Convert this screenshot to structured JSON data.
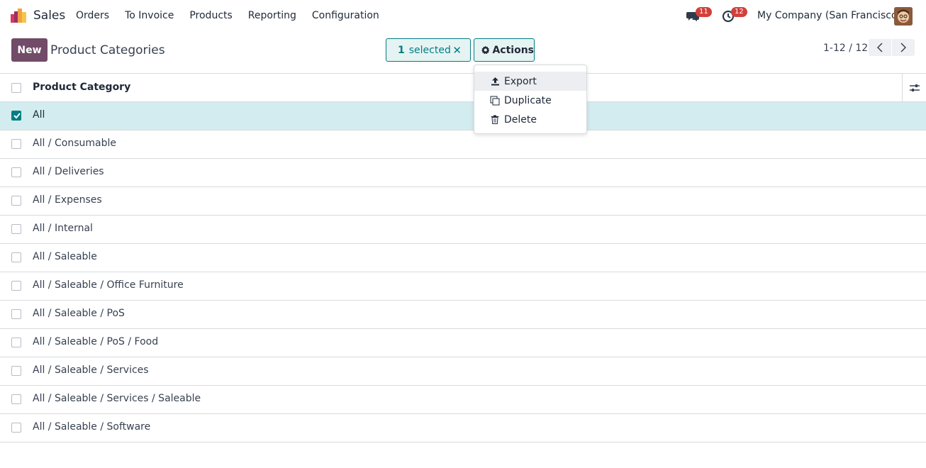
{
  "navbar": {
    "app_name": "Sales",
    "menu": [
      "Orders",
      "To Invoice",
      "Products",
      "Reporting",
      "Configuration"
    ],
    "chat_badge": "11",
    "activity_badge": "12",
    "company": "My Company (San Francisco)"
  },
  "control_panel": {
    "new_label": "New",
    "title": "Product Categories",
    "selected_count": "1",
    "selected_label": "selected",
    "actions_label": "Actions",
    "pager": "1-12 / 12"
  },
  "table": {
    "header": "Product Category",
    "rows": [
      {
        "name": "All",
        "selected": true
      },
      {
        "name": "All / Consumable",
        "selected": false
      },
      {
        "name": "All / Deliveries",
        "selected": false
      },
      {
        "name": "All / Expenses",
        "selected": false
      },
      {
        "name": "All / Internal",
        "selected": false
      },
      {
        "name": "All / Saleable",
        "selected": false
      },
      {
        "name": "All / Saleable / Office Furniture",
        "selected": false
      },
      {
        "name": "All / Saleable / PoS",
        "selected": false
      },
      {
        "name": "All / Saleable / PoS / Food",
        "selected": false
      },
      {
        "name": "All / Saleable / Services",
        "selected": false
      },
      {
        "name": "All / Saleable / Services / Saleable",
        "selected": false
      },
      {
        "name": "All / Saleable / Software",
        "selected": false
      }
    ]
  },
  "actions_menu": {
    "items": [
      "Export",
      "Duplicate",
      "Delete"
    ],
    "active": "Export"
  },
  "colors": {
    "brand": "#714b67",
    "accent": "#017e84",
    "selected_row": "#d3ecf0",
    "badge": "#d23f3a"
  },
  "icons": [
    "sales-logo-icon",
    "chat-icon",
    "clock-icon",
    "gear-icon",
    "close-icon",
    "chevron-left-icon",
    "chevron-right-icon",
    "sliders-icon",
    "upload-icon",
    "copy-icon",
    "trash-icon",
    "check-icon"
  ]
}
